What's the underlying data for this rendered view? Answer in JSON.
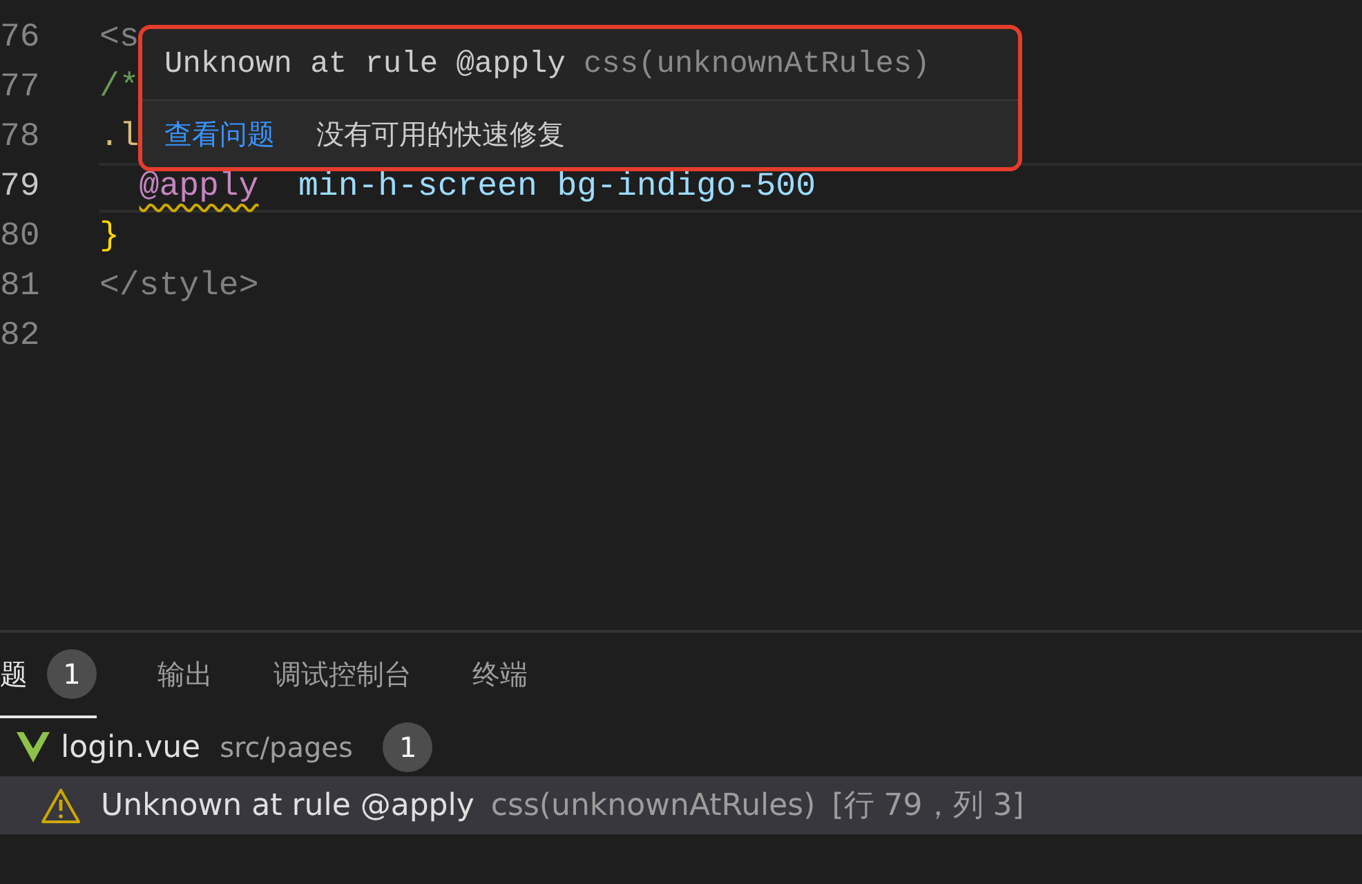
{
  "editor": {
    "lines": [
      {
        "number": "76",
        "current": false,
        "tokens": [
          {
            "kind": "tag",
            "text": "<s"
          }
        ]
      },
      {
        "number": "77",
        "current": false,
        "tokens": [
          {
            "kind": "comment",
            "text": "/*"
          }
        ]
      },
      {
        "number": "78",
        "current": false,
        "tokens": [
          {
            "kind": "selector",
            "text": ".l"
          }
        ]
      },
      {
        "number": "79",
        "current": true,
        "indented": true,
        "tokens": [
          {
            "kind": "keyword",
            "text": "@apply",
            "squiggle": true
          },
          {
            "kind": "value",
            "text": "min-h-screen bg-indigo-500"
          }
        ]
      },
      {
        "number": "80",
        "current": false,
        "tokens": [
          {
            "kind": "brace",
            "text": "}"
          }
        ]
      },
      {
        "number": "81",
        "current": false,
        "tokens": [
          {
            "kind": "tag",
            "text": "</style>"
          }
        ]
      },
      {
        "number": "82",
        "current": false
      }
    ]
  },
  "hover": {
    "message": "Unknown at rule @apply",
    "source": "css(unknownAtRules)",
    "link": "查看问题",
    "note": "没有可用的快速修复"
  },
  "panel": {
    "tabs": [
      {
        "label": "题",
        "badge": "1",
        "selected": true
      },
      {
        "label": "输出",
        "selected": false
      },
      {
        "label": "调试控制台",
        "selected": false
      },
      {
        "label": "终端",
        "selected": false
      }
    ],
    "problems": [
      {
        "file": "login.vue",
        "path": "src/pages",
        "count": "1",
        "children": [
          {
            "kind": "warning",
            "message": "Unknown at rule @apply",
            "source": "css(unknownAtRules)",
            "location": "[行 79，列 3]",
            "selected": true
          }
        ]
      }
    ]
  }
}
